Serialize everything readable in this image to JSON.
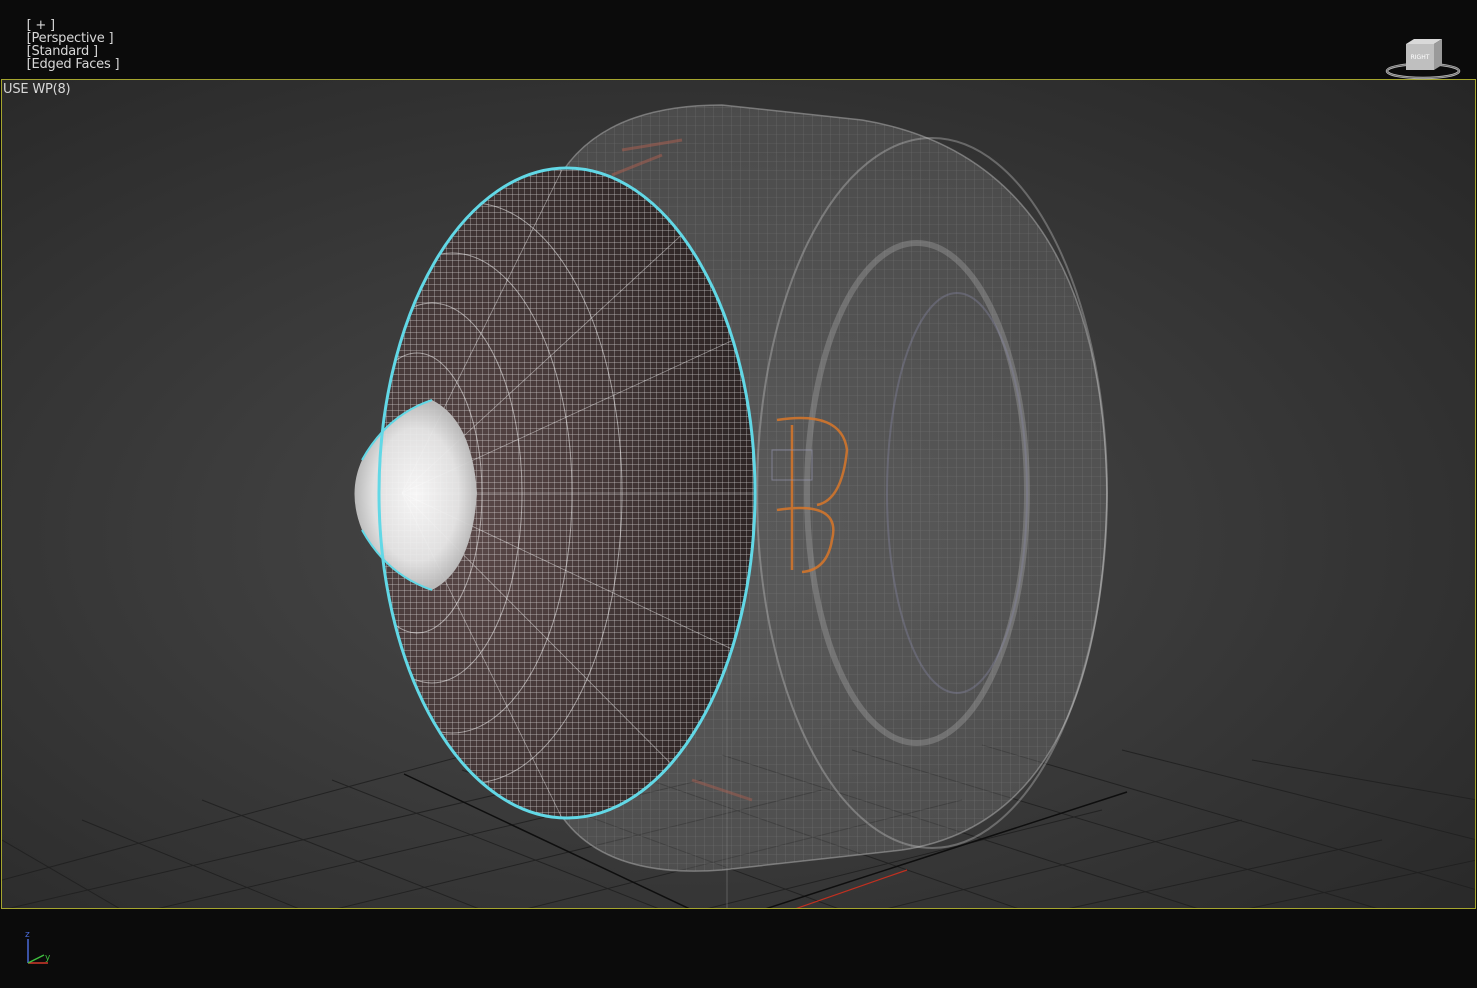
{
  "viewport": {
    "menu_plus": "[ + ]",
    "view_label": "[Perspective ]",
    "shading_label": "[Standard ]",
    "edged_label": "[Edged Faces ]",
    "subtitle": "USE WP(8)"
  },
  "viewcube": {
    "icon": "viewcube-icon",
    "face_label": "RIGHT"
  },
  "axis_tripod": {
    "z_label": "z",
    "y_label": "y",
    "x_color": "#d23a2a",
    "y_color": "#3fbf3f",
    "z_color": "#4a6bd8"
  },
  "colors": {
    "viewport_border": "#a5a52e",
    "selection_outline": "#62d8e6",
    "wireframe_front": "#f2f2f2",
    "grid": "#1a1a1a"
  }
}
